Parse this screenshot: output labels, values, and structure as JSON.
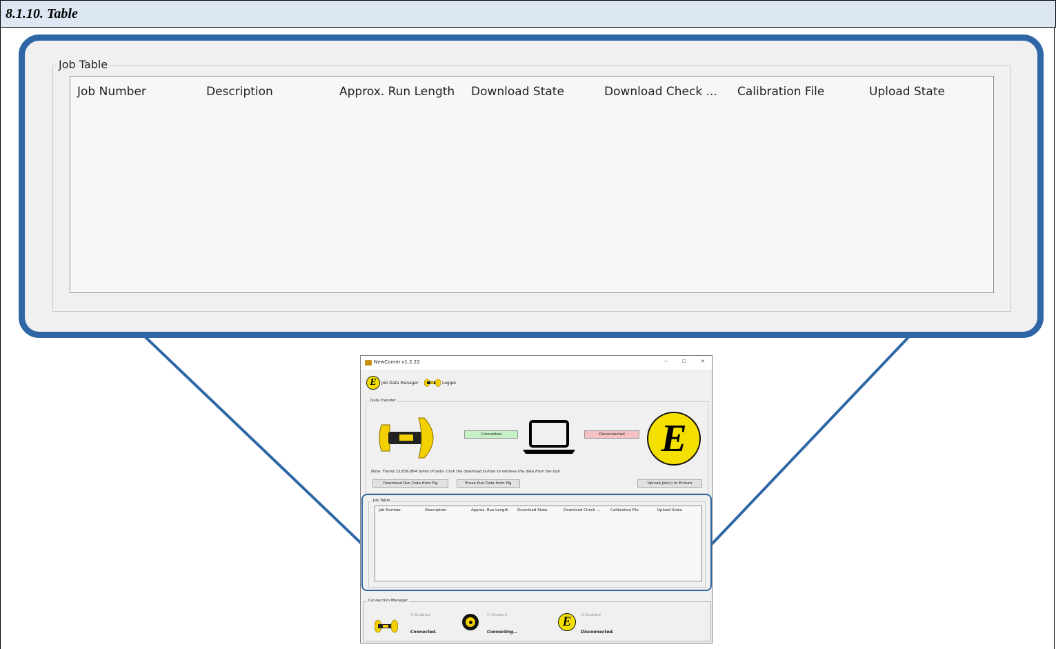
{
  "heading": "8.1.10. Table",
  "zoom": {
    "group_label": "Job Table",
    "columns": [
      "Job Number",
      "Description",
      "Approx. Run Length",
      "Download State",
      "Download Check ...",
      "Calibration File",
      "Upload State"
    ]
  },
  "window": {
    "title": "NewComm v1.2.22",
    "controls": [
      "–",
      "☐",
      "✕"
    ],
    "tabs": [
      {
        "label": "Job Data Manager",
        "icon": "enduro-e-icon"
      },
      {
        "label": "Logger",
        "icon": "pig-icon"
      }
    ],
    "data_transfer": {
      "label": "Data Transfer",
      "pig_status": "Connected",
      "enduro_status": "Disconnected",
      "note": "Note: Found 12,836,864 bytes of data. Click the download button to retrieve the data from the tool.",
      "buttons": {
        "download": "Download Run Data from Pig",
        "erase": "Erase Run Data from Pig",
        "upload": "Upload Job(s) to Enduro"
      }
    },
    "job_table": {
      "label": "Job Table",
      "columns": [
        "Job Number",
        "Description",
        "Approx. Run Length",
        "Download State",
        "Download Check ...",
        "Calibration File",
        "Upload State"
      ]
    },
    "connection_manager": {
      "label": "Connection Manager",
      "items": [
        {
          "icon": "pig-icon",
          "checkbox": "Enabled",
          "state": "Connected."
        },
        {
          "icon": "receiver-icon",
          "checkbox": "Enabled",
          "state": "Connecting..."
        },
        {
          "icon": "enduro-e-icon",
          "checkbox": "Enabled",
          "state": "Disconnected."
        }
      ]
    }
  },
  "colors": {
    "heading_bg": "#dde7f3",
    "callout_border": "#2f67a6",
    "connected_bg": "#c6f0c6",
    "disconnected_bg": "#f4c2c2",
    "enduro_yellow": "#f3e000"
  }
}
